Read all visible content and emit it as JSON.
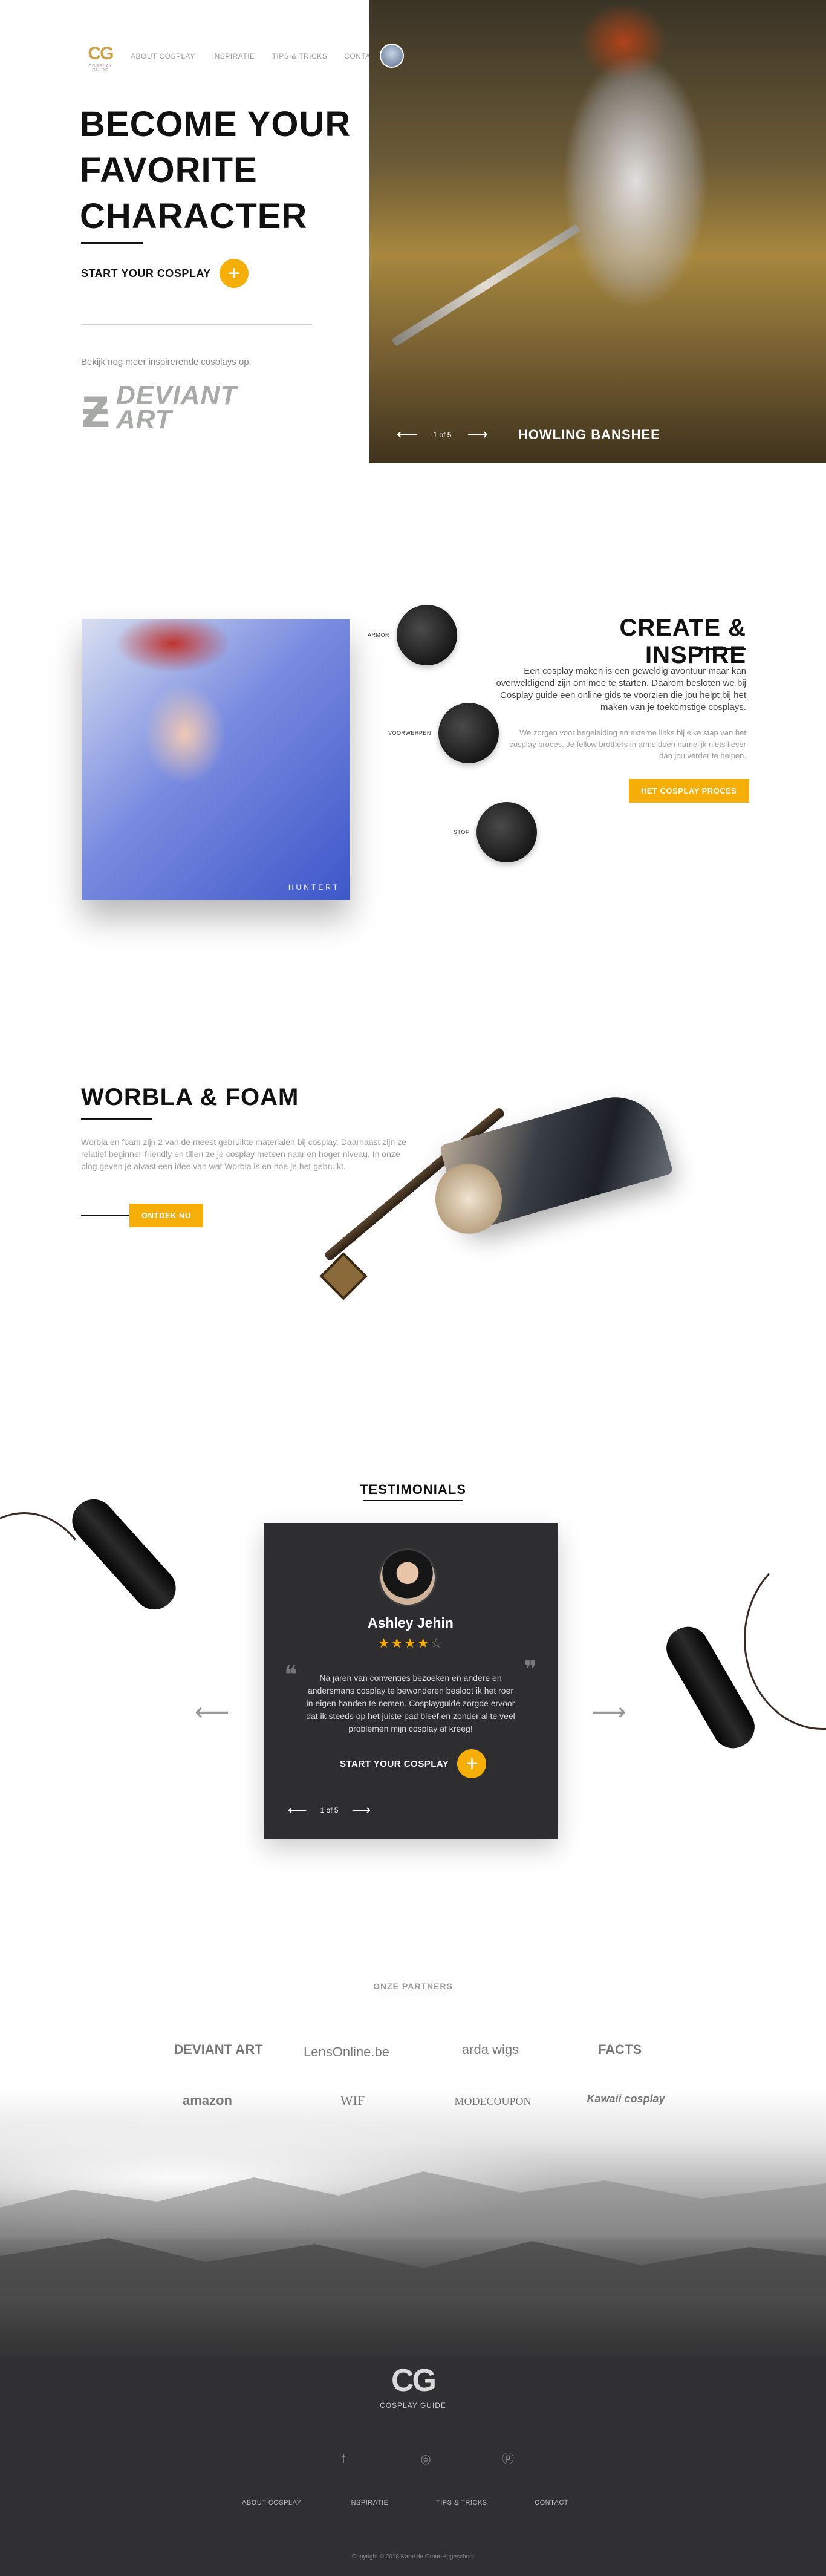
{
  "header": {
    "logo_mark": "CG",
    "logo_sub": "COSPLAY GUIDE",
    "nav": [
      "ABOUT COSPLAY",
      "INSPIRATIE",
      "TIPS & TRICKS",
      "CONTACT"
    ]
  },
  "hero": {
    "title_lines": [
      "BECOME YOUR",
      "FAVORITE",
      "CHARACTER"
    ],
    "cta_label": "START YOUR COSPLAY",
    "more_text": "Bekijk nog meer inspirerende cosplays op:",
    "deviant": {
      "line1": "DEVIANT",
      "line2": "ART"
    },
    "slider": {
      "prev": "⟵",
      "counter": "1 of 5",
      "next": "⟶",
      "name": "HOWLING BANSHEE"
    }
  },
  "create": {
    "title": "CREATE & INSPIRE",
    "paragraph1": "Een cosplay maken is een geweldig avontuur maar kan overweldigend zijn om mee te starten. Daarom besloten we bij Cosplay guide een online gids te voorzien die jou helpt bij het maken van je toekomstige cosplays.",
    "paragraph2": "We zorgen voor begeleiding en externe links bij elke stap van het cosplay proces. Je fellow brothers in arms doen namelijk niets liever dan jou verder te helpen.",
    "button": "HET COSPLAY PROCES",
    "bubbles": [
      "ARMOR",
      "VOORWERPEN",
      "STOF"
    ],
    "art_signature": "HUNTERT"
  },
  "worbla": {
    "title": "WORBLA & FOAM",
    "paragraph": "Worbla en foam zijn 2 van de meest gebruikte materialen bij cosplay. Daarnaast zijn ze relatief beginner-friendly en tillen ze je cosplay meteen naar en hoger niveau. In onze blog geven je alvast een idee van wat Worbla is en hoe je het gebruikt.",
    "button": "ONTDEK NU"
  },
  "testimonials": {
    "heading": "TESTIMONIALS",
    "name": "Ashley Jehin",
    "rating": 4,
    "max_rating": 5,
    "stars_on": "★★★★",
    "stars_off": "☆",
    "quote": "Na jaren van conventies bezoeken en andere en andersmans cosplay te bewonderen besloot ik het roer in eigen handen te nemen. Cosplayguide zorgde ervoor dat ik steeds op het juiste pad bleef en zonder al te veel problemen mijn cosplay af kreeg!",
    "cta_label": "START YOUR COSPLAY",
    "counter": "1 of 5",
    "prev": "⟵",
    "next": "⟶",
    "quote_open": "❝",
    "quote_close": "❞",
    "side_prev": "⟵",
    "side_next": "⟶"
  },
  "partners": {
    "heading": "ONZE PARTNERS",
    "row1": [
      "DEVIANT ART",
      "LensOnline.be",
      "arda wigs",
      "FACTS"
    ],
    "row2": [
      "amazon",
      "WIF",
      "MODECOUPON",
      "Kawaii cosplay"
    ]
  },
  "footer": {
    "logo_mark": "CG",
    "logo_sub": "COSPLAY GUIDE",
    "social": [
      "f",
      "◎",
      "ⓟ"
    ],
    "nav": [
      "ABOUT COSPLAY",
      "INSPIRATIE",
      "TIPS & TRICKS",
      "CONTACT"
    ],
    "copyright": "Copyright © 2018 Karel de Grote-Hogeschool"
  },
  "colors": {
    "accent": "#f6ae08",
    "dark": "#2e2d2f",
    "logo_gold": "#c9a24a"
  }
}
